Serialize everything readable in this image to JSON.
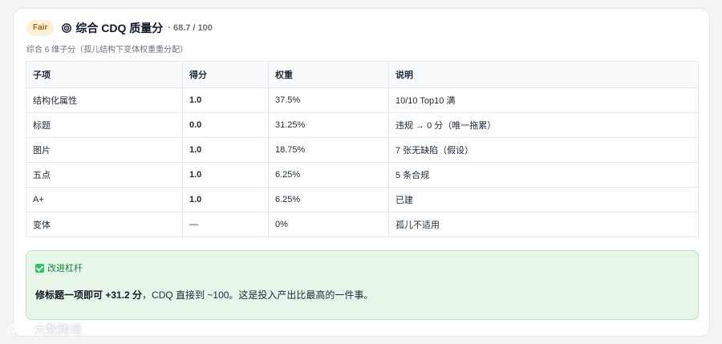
{
  "header": {
    "badge": "Fair",
    "title": "综合 CDQ 质量分",
    "score": "· 68.7 / 100",
    "subtitle": "综合 6 维子分（孤儿结构下变体权重重分配）"
  },
  "table": {
    "columns": [
      "子项",
      "得分",
      "权重",
      "说明"
    ],
    "rows": [
      {
        "item": "结构化属性",
        "score": "1.0",
        "weight": "37.5%",
        "note": "10/10 Top10 满"
      },
      {
        "item": "标题",
        "score": "0.0",
        "weight": "31.25%",
        "note": "违规 → 0 分（唯一拖累）"
      },
      {
        "item": "图片",
        "score": "1.0",
        "weight": "18.75%",
        "note": "7 张无缺陷（假设）"
      },
      {
        "item": "五点",
        "score": "1.0",
        "weight": "6.25%",
        "note": "5 条合规"
      },
      {
        "item": "A+",
        "score": "1.0",
        "weight": "6.25%",
        "note": "已建"
      },
      {
        "item": "变体",
        "score": "—",
        "weight": "0%",
        "note": "孤儿不适用"
      }
    ]
  },
  "callout": {
    "title": "改进杠杆",
    "body_strong": "修标题一项即可 +31.2 分",
    "body_rest": "，CDQ 直接到 ~100。这是投入产出比最高的一件事。"
  },
  "watermark": {
    "text": "大数跨境"
  },
  "colors": {
    "badge_bg": "#fdf0d5",
    "badge_text": "#a8661c",
    "good": "#15803d",
    "bad": "#dc2626",
    "callout_bg": "#e8f6ea"
  }
}
